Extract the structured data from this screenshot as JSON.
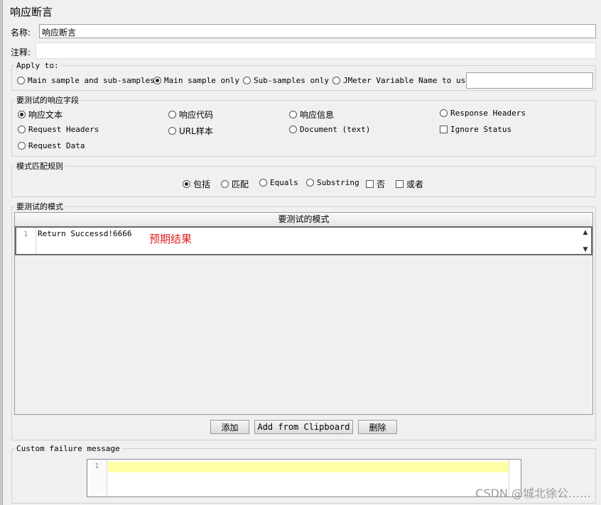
{
  "panel": {
    "title": "响应断言"
  },
  "name_row": {
    "label": "名称:",
    "value": "响应断言"
  },
  "comment_row": {
    "label": "注释:",
    "value": ""
  },
  "apply_to": {
    "legend": "Apply to:",
    "options": [
      {
        "label": "Main sample and sub-samples",
        "selected": false
      },
      {
        "label": "Main sample only",
        "selected": true
      },
      {
        "label": "Sub-samples only",
        "selected": false
      },
      {
        "label": "JMeter Variable Name to use",
        "selected": false
      }
    ],
    "variable_value": ""
  },
  "field_to_test": {
    "legend": "要测试的响应字段",
    "options": [
      {
        "label": "响应文本",
        "kind": "radio",
        "selected": true
      },
      {
        "label": "响应代码",
        "kind": "radio",
        "selected": false
      },
      {
        "label": "响应信息",
        "kind": "radio",
        "selected": false
      },
      {
        "label": "Response Headers",
        "kind": "radio",
        "selected": false
      },
      {
        "label": "Request Headers",
        "kind": "radio",
        "selected": false
      },
      {
        "label": "URL样本",
        "kind": "radio",
        "selected": false
      },
      {
        "label": "Document (text)",
        "kind": "radio",
        "selected": false
      },
      {
        "label": "Ignore Status",
        "kind": "checkbox",
        "selected": false
      },
      {
        "label": "Request Data",
        "kind": "radio",
        "selected": false
      }
    ]
  },
  "pattern_matching": {
    "legend": "模式匹配规则",
    "options": [
      {
        "label": "包括",
        "kind": "radio",
        "selected": true
      },
      {
        "label": "匹配",
        "kind": "radio",
        "selected": false
      },
      {
        "label": "Equals",
        "kind": "radio",
        "selected": false
      },
      {
        "label": "Substring",
        "kind": "radio",
        "selected": false
      },
      {
        "label": "否",
        "kind": "checkbox",
        "selected": false
      },
      {
        "label": "或者",
        "kind": "checkbox",
        "selected": false
      }
    ]
  },
  "patterns": {
    "legend": "要测试的模式",
    "column_header": "要测试的模式",
    "rows": [
      {
        "line": "1",
        "value": "Return Successd!6666"
      }
    ],
    "annotation": "预期结果",
    "buttons": {
      "add": "添加",
      "add_clipboard": "Add from Clipboard",
      "delete": "删除"
    }
  },
  "custom_failure": {
    "legend": "Custom failure message",
    "line": "1",
    "value": ""
  },
  "watermark": "CSDN @城北徐公……",
  "icons": {
    "scroll_up": "▲",
    "scroll_down": "▼"
  }
}
